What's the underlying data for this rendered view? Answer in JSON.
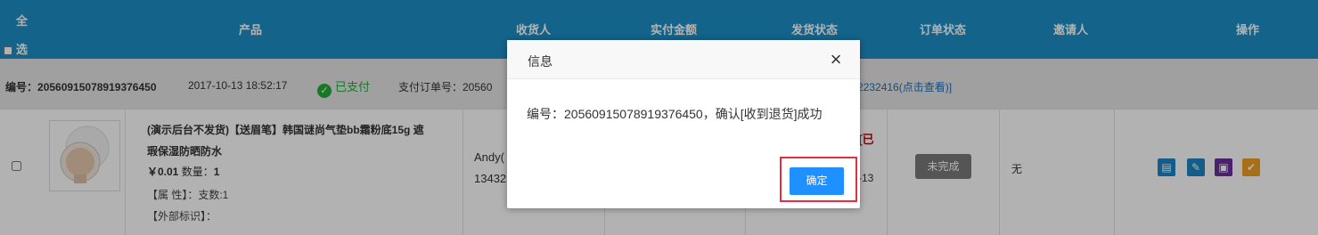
{
  "header": {
    "select_all": "全选",
    "columns": {
      "product": "产品",
      "receiver": "收货人",
      "paid_amount": "实付金额",
      "ship_status": "发货状态",
      "order_status": "订单状态",
      "inviter": "邀请人",
      "actions": "操作"
    }
  },
  "order": {
    "number_label": "编号：",
    "number": "20560915078919376450",
    "datetime": "2017-10-13 18:52:17",
    "paid_status": "已支付",
    "pay_order_label": "支付订单号：20560",
    "pay_order_suffix": "2232416(点击查看)]"
  },
  "product": {
    "title": "(演示后台不发货)【送眉笔】韩国谜尚气垫bb霜粉底15g 遮瑕保湿防晒防水",
    "price": "￥0.01",
    "qty_label": "数量：",
    "qty": "1",
    "attr_label": "【属 性】：支数:1",
    "ext_label": "【外部标识】："
  },
  "receiver": {
    "name": "Andy(",
    "phone": "13432"
  },
  "ship": {
    "status_partial": ")[已",
    "date_partial": "-13"
  },
  "order_status_badge": "未完成",
  "inviter_value": "无",
  "action_icons": [
    "detail-icon",
    "edit-icon",
    "ship-icon",
    "refund-icon"
  ],
  "colors": {
    "header_bg": "#1e8fc6",
    "ok_button": "#1e90ff",
    "highlight": "#e03040",
    "paid_green": "#22ac38"
  },
  "dialog": {
    "title": "信息",
    "message": "编号：20560915078919376450，确认[收到退货]成功",
    "ok_label": "确定"
  }
}
